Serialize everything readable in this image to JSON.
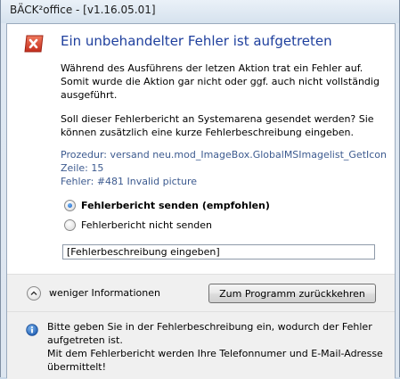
{
  "window": {
    "title": "BÄCK²office - [v1.16.05.01]"
  },
  "dialog": {
    "heading": "Ein unbehandelter Fehler ist aufgetreten",
    "message": [
      "Während des Ausführens der letzen Aktion trat ein Fehler auf.",
      "Somit wurde die Aktion gar nicht oder ggf. auch nicht vollständig",
      "ausgeführt."
    ],
    "question": [
      "Soll dieser Fehlerbericht an Systemarena gesendet werden? Sie",
      "können zusätzlich eine kurze Fehlerbeschreibung eingeben."
    ],
    "details": [
      "Prozedur: versand neu.mod_ImageBox.GlobalMSImagelist_GetIcon",
      "Zeile: 15",
      "Fehler: #481 Invalid picture"
    ],
    "options": [
      {
        "label": "Fehlerbericht senden (empfohlen)",
        "checked": true
      },
      {
        "label": "Fehlerbericht nicht senden",
        "checked": false
      }
    ],
    "description_input": {
      "value": "[Fehlerbeschreibung eingeben]"
    },
    "toggle_details_label": "weniger Informationen",
    "return_button_label": "Zum Programm zurückkehren",
    "info": [
      "Bitte geben Sie in der Fehlerbeschreibung ein, wodurch der Fehler",
      "aufgetreten ist.",
      "Mit dem Fehlerbericht werden Ihre Telefonnumer und E-Mail-Adresse",
      "übermittelt!"
    ]
  },
  "colors": {
    "heading": "#1e3f9d",
    "details_text": "#3c5a8f",
    "error_icon": "#d23a2a"
  },
  "icons": {
    "error": "error-icon",
    "toggle": "chevron-up-icon",
    "info": "info-icon"
  }
}
